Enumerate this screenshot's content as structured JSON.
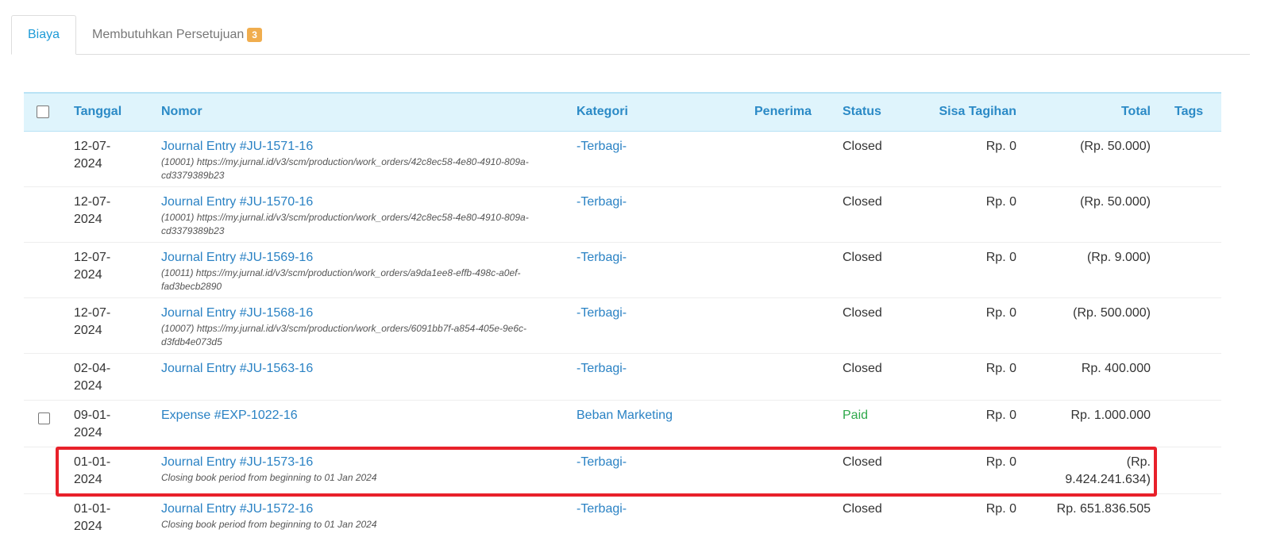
{
  "tabs": {
    "biaya": "Biaya",
    "approval": "Membutuhkan Persetujuan",
    "approval_count": "3"
  },
  "columns": {
    "tanggal": "Tanggal",
    "nomor": "Nomor",
    "kategori": "Kategori",
    "penerima": "Penerima",
    "status": "Status",
    "sisa": "Sisa Tagihan",
    "total": "Total",
    "tags": "Tags"
  },
  "rows": [
    {
      "date": "12-07-2024",
      "number": "Journal Entry #JU-1571-16",
      "memo": "(10001) https://my.jurnal.id/v3/scm/production/work_orders/42c8ec58-4e80-4910-809a-cd3379389b23",
      "category": "-Terbagi-",
      "recipient": "",
      "status": "Closed",
      "balance": "Rp. 0",
      "total": "(Rp. 50.000)",
      "tags": ""
    },
    {
      "date": "12-07-2024",
      "number": "Journal Entry #JU-1570-16",
      "memo": "(10001) https://my.jurnal.id/v3/scm/production/work_orders/42c8ec58-4e80-4910-809a-cd3379389b23",
      "category": "-Terbagi-",
      "recipient": "",
      "status": "Closed",
      "balance": "Rp. 0",
      "total": "(Rp. 50.000)",
      "tags": ""
    },
    {
      "date": "12-07-2024",
      "number": "Journal Entry #JU-1569-16",
      "memo": "(10011) https://my.jurnal.id/v3/scm/production/work_orders/a9da1ee8-effb-498c-a0ef-fad3becb2890",
      "category": "-Terbagi-",
      "recipient": "",
      "status": "Closed",
      "balance": "Rp. 0",
      "total": "(Rp. 9.000)",
      "tags": ""
    },
    {
      "date": "12-07-2024",
      "number": "Journal Entry #JU-1568-16",
      "memo": "(10007) https://my.jurnal.id/v3/scm/production/work_orders/6091bb7f-a854-405e-9e6c-d3fdb4e073d5",
      "category": "-Terbagi-",
      "recipient": "",
      "status": "Closed",
      "balance": "Rp. 0",
      "total": "(Rp. 500.000)",
      "tags": ""
    },
    {
      "date": "02-04-2024",
      "number": "Journal Entry #JU-1563-16",
      "memo": "",
      "category": "-Terbagi-",
      "recipient": "",
      "status": "Closed",
      "balance": "Rp. 0",
      "total": "Rp. 400.000",
      "tags": ""
    },
    {
      "date": "09-01-2024",
      "number": "Expense #EXP-1022-16",
      "memo": "",
      "category": "Beban Marketing",
      "recipient": "",
      "status": "Paid",
      "balance": "Rp. 0",
      "total": "Rp. 1.000.000",
      "tags": ""
    },
    {
      "date": "01-01-2024",
      "number": "Journal Entry #JU-1573-16",
      "memo": "Closing book period from beginning to 01 Jan 2024",
      "category": "-Terbagi-",
      "recipient": "",
      "status": "Closed",
      "balance": "Rp. 0",
      "total": "(Rp. 9.424.241.634)",
      "tags": ""
    },
    {
      "date": "01-01-2024",
      "number": "Journal Entry #JU-1572-16",
      "memo": "Closing book period from beginning to 01 Jan 2024",
      "category": "-Terbagi-",
      "recipient": "",
      "status": "Closed",
      "balance": "Rp. 0",
      "total": "Rp. 651.836.505",
      "tags": ""
    }
  ],
  "colors": {
    "accent": "#1e9bd7",
    "link": "#2a82c4",
    "paid": "#2ea84a",
    "badge": "#f0ad4e",
    "highlight": "#e8212a"
  }
}
